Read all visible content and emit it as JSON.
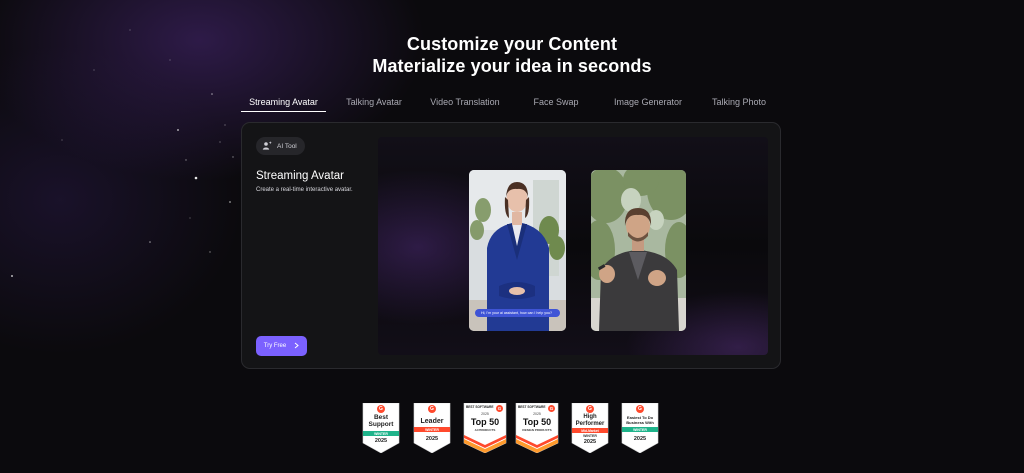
{
  "headline": {
    "line1": "Customize your Content",
    "line2": "Materialize your idea in seconds"
  },
  "tabs": [
    {
      "label": "Streaming Avatar",
      "active": true
    },
    {
      "label": "Talking Avatar",
      "active": false
    },
    {
      "label": "Video Translation",
      "active": false
    },
    {
      "label": "Face Swap",
      "active": false
    },
    {
      "label": "Image Generator",
      "active": false
    },
    {
      "label": "Talking Photo",
      "active": false
    }
  ],
  "card": {
    "badge_icon": "user-sparkle-icon",
    "badge_label": "AI Tool",
    "title": "Streaming Avatar",
    "description": "Create a real-time interactive avatar.",
    "cta_label": "Try Free",
    "cta_icon": "chevron-right-icon",
    "cta_color": "#7b61ff",
    "videos": [
      {
        "subject": "woman-in-blue-suit",
        "caption": "Hi, I'm your ai assistant, how can I help you?"
      },
      {
        "subject": "man-outdoors-gesturing"
      }
    ]
  },
  "awards": [
    {
      "brand_icon": "g2-logo-icon",
      "title_1": "Best",
      "title_2": "Support",
      "ribbon": "WINTER",
      "year": "2025",
      "ribbon_color": "#1fb38a"
    },
    {
      "brand_icon": "g2-logo-icon",
      "title_1": "Leader",
      "ribbon": "WINTER",
      "year": "2025",
      "ribbon_color": "#ff492c"
    },
    {
      "brand_icon": "g2-logo-icon",
      "kicker": "BEST SOFTWARE",
      "year_top": "2025",
      "title_1": "Top 50",
      "sub": "AI PRODUCTS",
      "ribbon_color": "#ff9a2c"
    },
    {
      "brand_icon": "g2-logo-icon",
      "kicker": "BEST SOFTWARE",
      "year_top": "2025",
      "title_1": "Top 50",
      "sub": "DESIGN PRODUCTS",
      "ribbon_color": "#ff9a2c"
    },
    {
      "brand_icon": "g2-logo-icon",
      "title_1": "High",
      "title_2": "Performer",
      "sub": "Mid-Market",
      "ribbon": "WINTER",
      "year": "2025",
      "ribbon_color": "#ff492c"
    },
    {
      "brand_icon": "g2-logo-icon",
      "title_1": "Easiest To Do",
      "title_2": "Business With",
      "ribbon": "WINTER",
      "year": "2025",
      "ribbon_color": "#1fb38a"
    }
  ]
}
